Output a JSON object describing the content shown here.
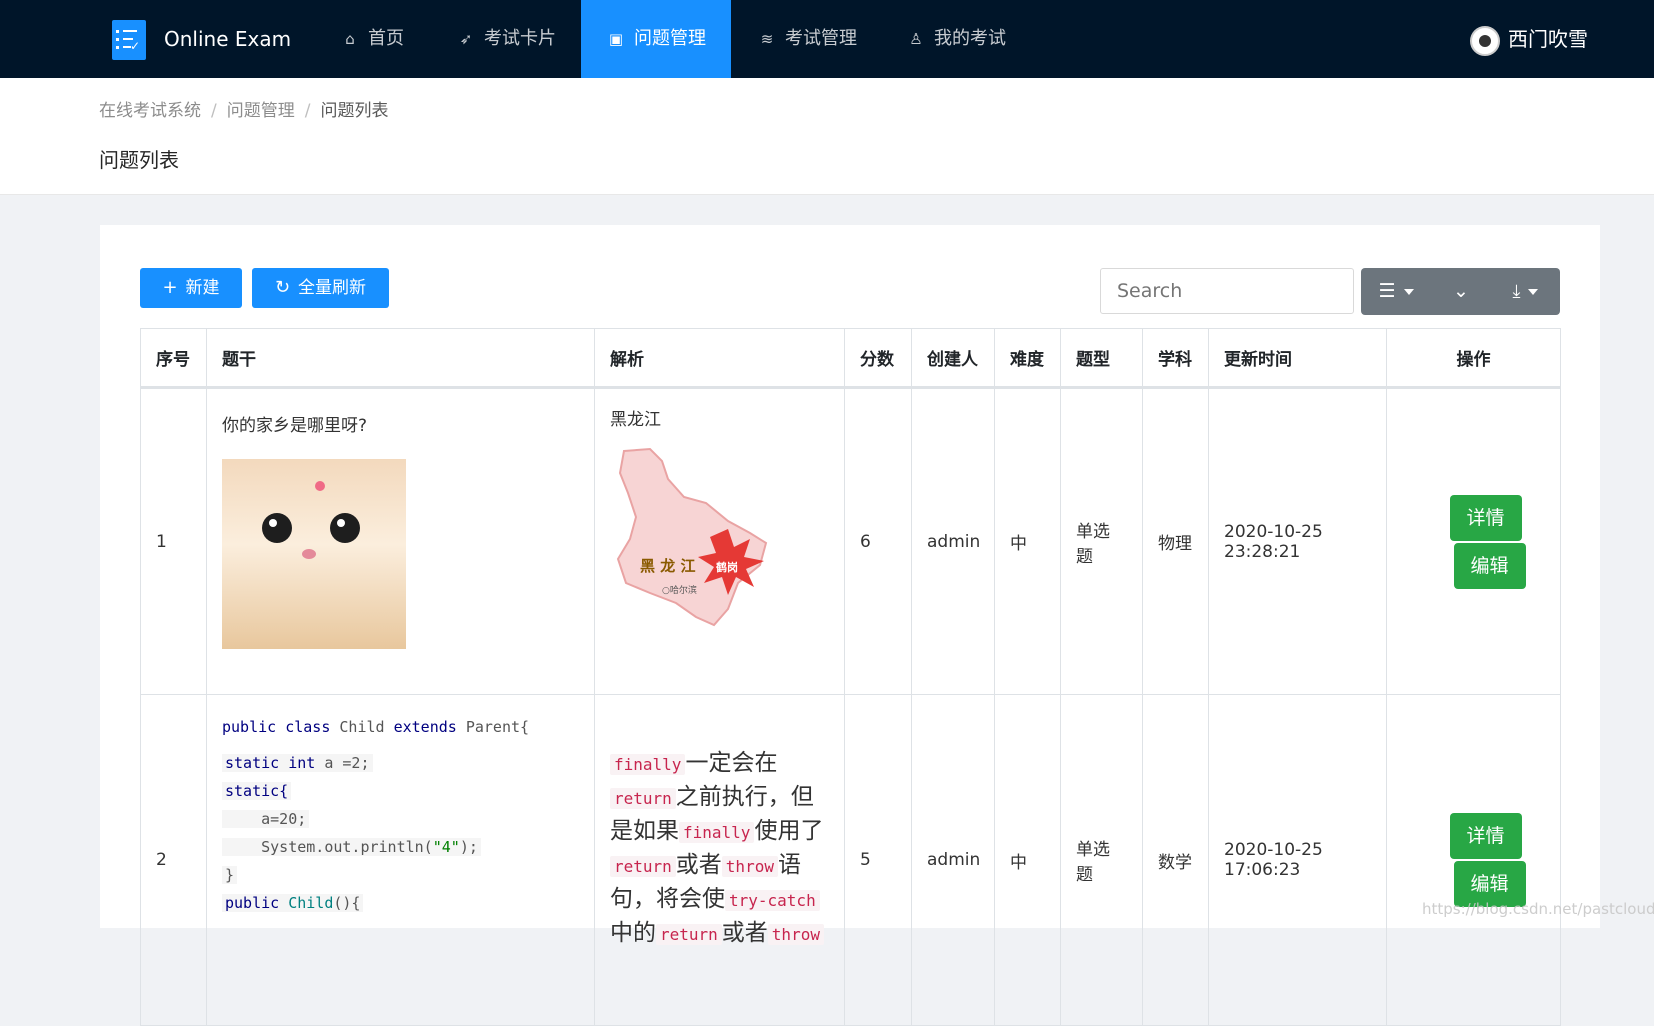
{
  "app": {
    "name": "Online Exam"
  },
  "nav": {
    "items": [
      {
        "label": "首页",
        "icon": "home-icon"
      },
      {
        "label": "考试卡片",
        "icon": "rocket-icon"
      },
      {
        "label": "问题管理",
        "icon": "question-file-icon",
        "active": true
      },
      {
        "label": "考试管理",
        "icon": "stack-icon"
      },
      {
        "label": "我的考试",
        "icon": "user-icon"
      }
    ],
    "user": "西门吹雪"
  },
  "breadcrumb": [
    "在线考试系统",
    "问题管理",
    "问题列表"
  ],
  "page_title": "问题列表",
  "toolbar": {
    "new_label": "新建",
    "refresh_label": "全量刷新",
    "search_placeholder": "Search"
  },
  "table": {
    "columns": [
      "序号",
      "题干",
      "解析",
      "分数",
      "创建人",
      "难度",
      "题型",
      "学科",
      "更新时间",
      "操作"
    ],
    "rows": [
      {
        "index": "1",
        "question": "你的家乡是哪里呀?",
        "analysis": "黑龙江",
        "map_label_main": "黑 龙 江",
        "map_label_badge": "鹤岗",
        "map_label_city": "○哈尔滨",
        "score": "6",
        "creator": "admin",
        "difficulty": "中",
        "type_line1": "单选",
        "type_line2": "题",
        "subject": "物理",
        "date": "2020-10-25",
        "time": "23:28:21",
        "detail_label": "详情",
        "edit_label": "编辑"
      },
      {
        "index": "2",
        "code": {
          "l1_kw1": "public",
          "l1_kw2": "class",
          "l1_name": "Child",
          "l1_kw3": "extends",
          "l1_name2": "Parent{",
          "l2_kw1": "static",
          "l2_ty": "int",
          "l2_rest": " a =2;",
          "l3": "static{",
          "l4": "    a=20;",
          "l5_pre": "    System.out.println(",
          "l5_str": "\"4\"",
          "l5_post": ");",
          "l6": "}",
          "l7_kw": "public",
          "l7_name": "Child",
          "l7_rest": "(){"
        },
        "analysis": {
          "c1": "finally",
          "t1": "一定会在",
          "c2": "return",
          "t2": "之前执行，但是如果",
          "c3": "finally",
          "t3": "使用了",
          "c4": "return",
          "t4": "或者",
          "c5": "throw",
          "t5": "语句，将会使",
          "c6": "try-catch",
          "t6": "中的",
          "c7": "return",
          "t7": "或者",
          "c8": "throw"
        },
        "score": "5",
        "creator": "admin",
        "difficulty": "中",
        "type_line1": "单选",
        "type_line2": "题",
        "subject": "数学",
        "date": "2020-10-25",
        "time": "17:06:23",
        "detail_label": "详情",
        "edit_label": "编辑"
      }
    ]
  },
  "watermark": "https://blog.csdn.net/pastclouds",
  "colors": {
    "nav_bg": "#001529",
    "primary": "#1890ff",
    "success": "#28a745",
    "secondary": "#6c757d"
  }
}
